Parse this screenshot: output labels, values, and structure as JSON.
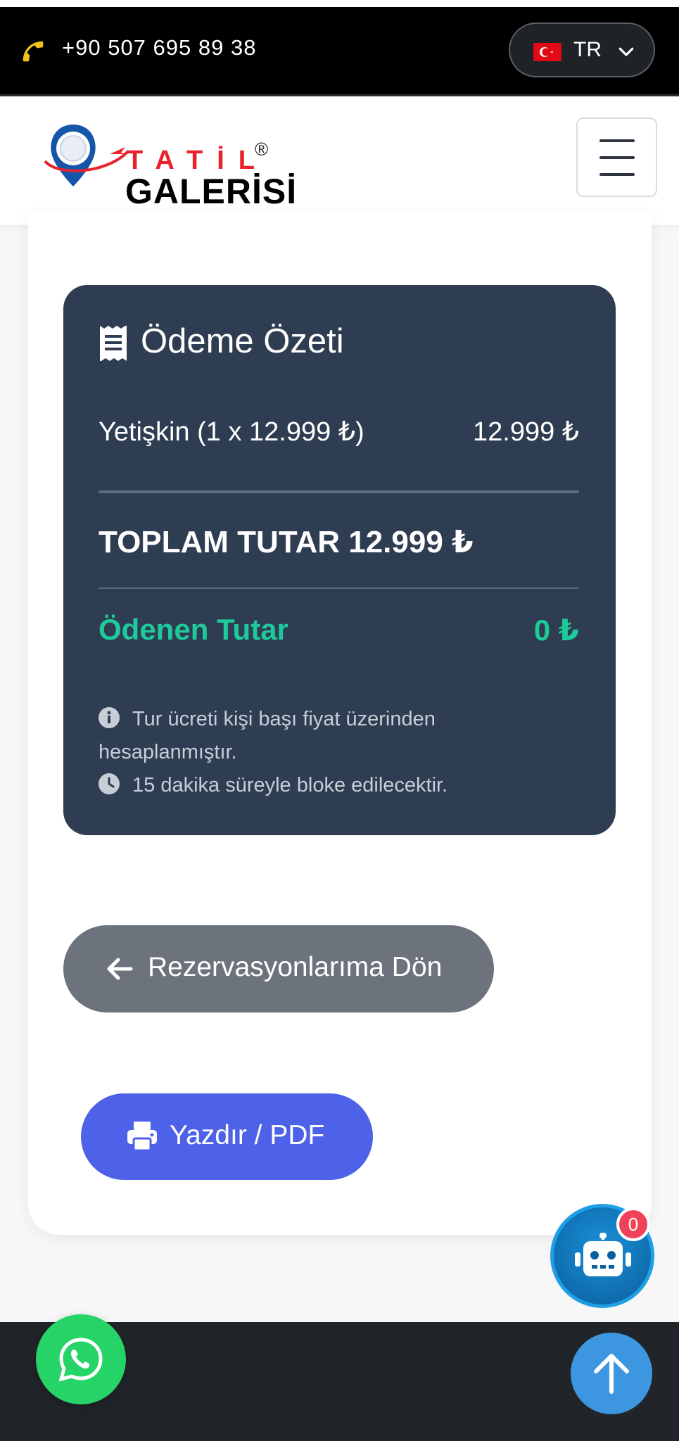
{
  "topbar": {
    "phone": "+90 507 695 89 38",
    "language": "TR",
    "icons": [
      "phone-icon",
      "turkey-flag",
      "chevron-down-icon"
    ]
  },
  "header": {
    "logo_top": "TATİL",
    "logo_bottom": "GALERİSİ",
    "logo_reg": "®",
    "menu_icon": "hamburger-icon"
  },
  "summary": {
    "title": "Ödeme Özeti",
    "line_label": "Yetişkin (1 x 12.999 ₺)",
    "line_value": "12.999 ₺",
    "total": "TOPLAM TUTAR 12.999 ₺",
    "paid_label": "Ödenen Tutar",
    "paid_value": "0 ₺",
    "note_1": "Tur ücreti kişi başı fiyat üzerinden hesaplanmıştır.",
    "note_2": "15 dakika süreyle bloke edilecektir."
  },
  "actions": {
    "back_label": "Rezervasyonlarıma Dön",
    "print_label": "Yazdır / PDF"
  },
  "floating": {
    "bot_badge": "0"
  },
  "colors": {
    "summary_bg": "#2e3d51",
    "paid_green": "#1ec99a",
    "back_gray": "#6c737c",
    "print_blue": "#4d62e8",
    "whatsapp_green": "#25d366",
    "scroll_top_blue": "#3d97e0"
  }
}
